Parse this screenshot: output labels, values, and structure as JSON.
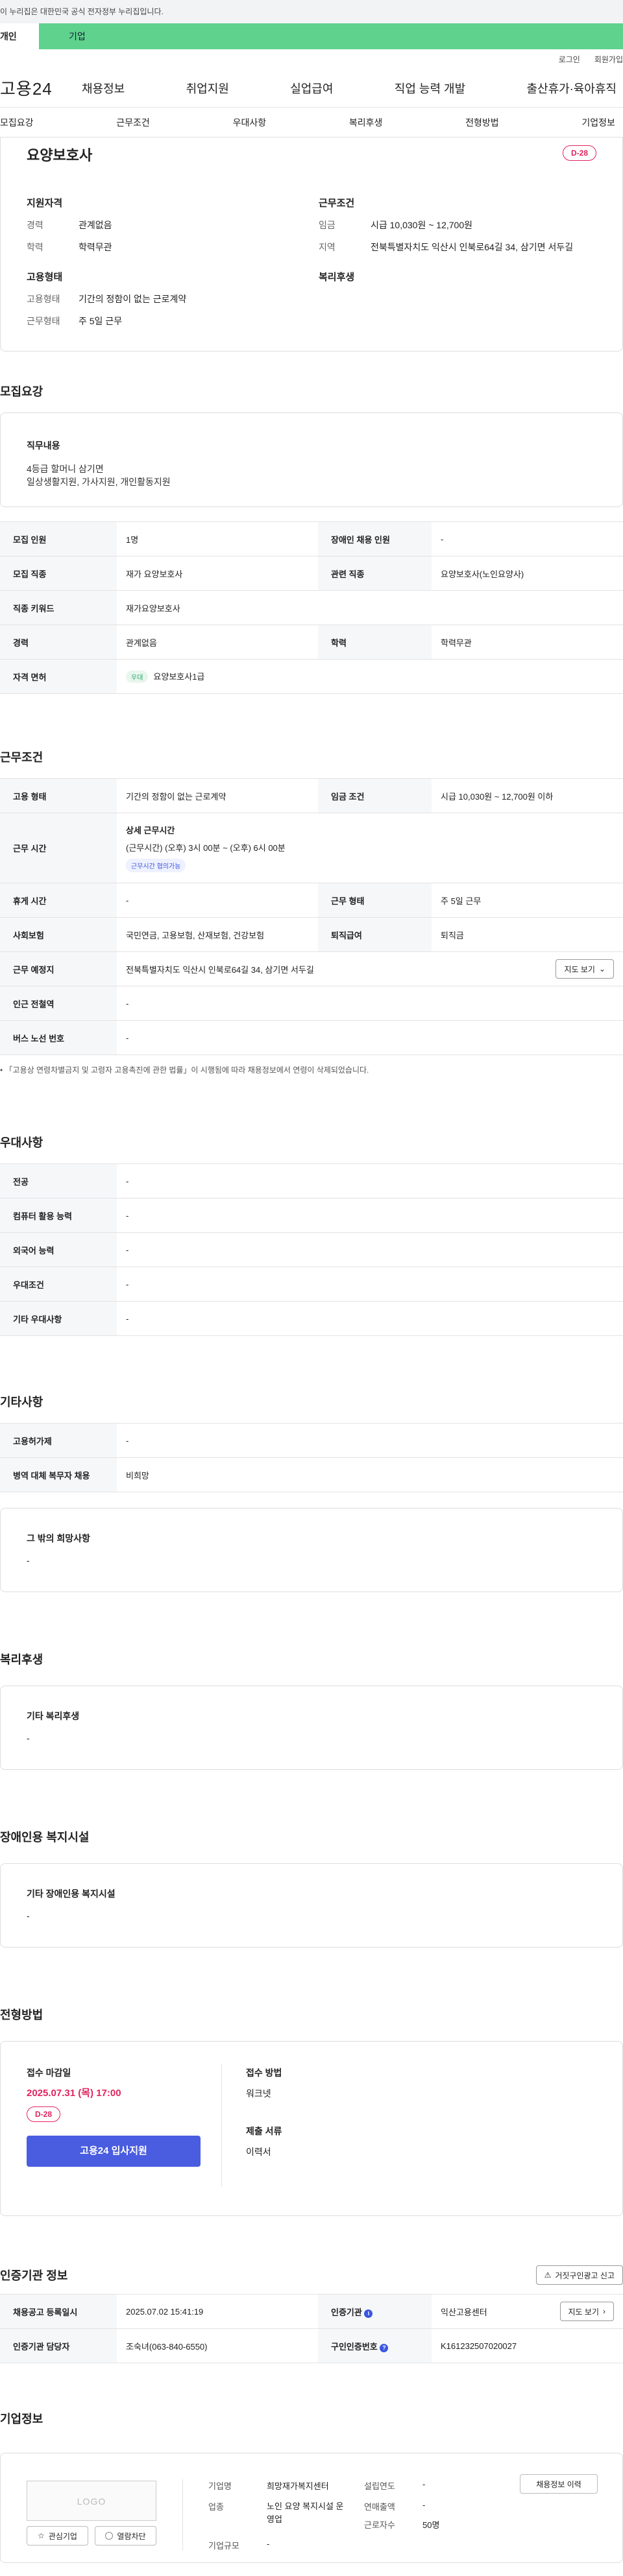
{
  "notice": {
    "text": "이 누리집은 대한민국 공식 전자정부 누리집입니다."
  },
  "top_tabs": {
    "personal": "개인",
    "company": "기업"
  },
  "util": {
    "login": "로그인",
    "join": "회원가입"
  },
  "gnb": {
    "logo": "고용24",
    "menu": [
      "채용정보",
      "취업지원",
      "실업급여",
      "직업 능력 개발",
      "출산휴가·육아휴직"
    ]
  },
  "snb": [
    "모집요강",
    "근무조건",
    "우대사항",
    "복리후생",
    "전형방법",
    "기업정보"
  ],
  "hero": {
    "title": "요양보호사",
    "dday": "D-28",
    "qual": {
      "title": "지원자격",
      "rows": [
        {
          "k": "경력",
          "v": "관계없음"
        },
        {
          "k": "학력",
          "v": "학력무관"
        }
      ]
    },
    "cond": {
      "title": "근무조건",
      "rows": [
        {
          "k": "임금",
          "v": "시급 10,030원 ~ 12,700원"
        },
        {
          "k": "지역",
          "v": "전북특별자치도 익산시 인북로64길 34, 삼기면 서두길"
        }
      ]
    },
    "employ": {
      "title": "고용형태",
      "rows": [
        {
          "k": "고용형태",
          "v": "기간의 정함이 없는 근로계약"
        },
        {
          "k": "근무형태",
          "v": "주 5일 근무"
        }
      ]
    },
    "welfare": {
      "title": "복리후생"
    }
  },
  "recruit": {
    "title": "모집요강",
    "duty_title": "직무내용",
    "duty_lines": [
      "4등급 할머니  삼기면",
      "일상생활지원, 가사지원, 개인활동지원"
    ],
    "rows": [
      [
        "모집 인원",
        "1명",
        "장애인 채용 인원",
        "-"
      ],
      [
        "모집 직종",
        "재가 요양보호사",
        "관련 직종",
        "요양보호사(노인요양사)"
      ],
      [
        "직종 키워드",
        "재가요양보호사"
      ],
      [
        "경력",
        "관계없음",
        "학력",
        "학력무관"
      ],
      [
        "자격 면허",
        "요양보호사1급"
      ]
    ],
    "license_tag": "우대"
  },
  "work": {
    "title": "근무조건",
    "employ_type_label": "고용 형태",
    "employ_type": "기간의 정함이 없는 근로계약",
    "wage_label": "임금 조건",
    "wage": "시급 10,030원 ~ 12,700원 이하",
    "hours_label": "근무 시간",
    "hours_title": "상세 근무시간",
    "hours_value": "(근무시간) (오후) 3시 00분 ~ (오후) 6시 00분",
    "hours_tag": "근무시간 협의가능",
    "rest_label": "휴게 시간",
    "rest": "-",
    "shape_label": "근무 형태",
    "shape": "주 5일 근무",
    "insurance_label": "사회보험",
    "insurance": "국민연금, 고용보험, 산재보험, 건강보험",
    "retire_label": "퇴직급여",
    "retire": "퇴직금",
    "place_label": "근무 예정지",
    "place": "전북특별자치도 익산시 인북로64길 34, 삼기면 서두길",
    "map_btn": "지도 보기",
    "subway_label": "인근 전철역",
    "subway": "-",
    "bus_label": "버스 노선 번호",
    "bus": "-",
    "note": "「고용상 연령차별금지 및 고령자 고용촉진에 관한 법률」이 시행됨에 따라 채용정보에서 연령이 삭제되었습니다."
  },
  "prefer": {
    "title": "우대사항",
    "rows": [
      [
        "전공",
        "-"
      ],
      [
        "컴퓨터 활용 능력",
        "-"
      ],
      [
        "외국어 능력",
        "-"
      ],
      [
        "우대조건",
        "-"
      ],
      [
        "기타 우대사항",
        "-"
      ]
    ]
  },
  "etc": {
    "title": "기타사항",
    "rows": [
      [
        "고용허가제",
        "-"
      ],
      [
        "병역 대체 복무자 채용",
        "비희망"
      ]
    ],
    "hope_title": "그 밖의 희망사항",
    "hope": "-"
  },
  "welfare": {
    "title": "복리후생",
    "box_title": "기타 복리후생",
    "box_value": "-"
  },
  "disabled": {
    "title": "장애인용 복지시설",
    "box_title": "기타 장애인용 복지시설",
    "box_value": "-"
  },
  "apply": {
    "title": "전형방법",
    "deadline_label": "접수 마감일",
    "deadline": "2025.07.31 (목) 17:00",
    "dday": "D-28",
    "button": "고용24 입사지원",
    "method_label": "접수 방법",
    "method": "워크넷",
    "docs_label": "제출 서류",
    "docs": "이력서"
  },
  "agency": {
    "title": "인증기관 정보",
    "report_btn": "거짓구인광고 신고",
    "reg_label": "채용공고 등록일시",
    "reg": "2025.07.02 15:41:19",
    "org_label": "인증기관",
    "org": "익산고용센터",
    "map_btn": "지도 보기",
    "mgr_label": "인증기관 담당자",
    "mgr": "조숙녀(063-840-6550)",
    "no_label": "구인인증번호",
    "no": "K161232507020027"
  },
  "company": {
    "title": "기업정보",
    "logo": "LOGO",
    "fav_btn": "관심기업",
    "block_btn": "열람차단",
    "name_label": "기업명",
    "name": "희망재가복지센터",
    "biz_label": "업종",
    "biz": "노인 요양 복지시설 운영업",
    "size_label": "기업규모",
    "size": "-",
    "est_label": "설립연도",
    "est": "-",
    "sales_label": "연매출액",
    "sales": "-",
    "emp_label": "근로자수",
    "emp": "50명",
    "history_btn": "채용정보 이력"
  }
}
